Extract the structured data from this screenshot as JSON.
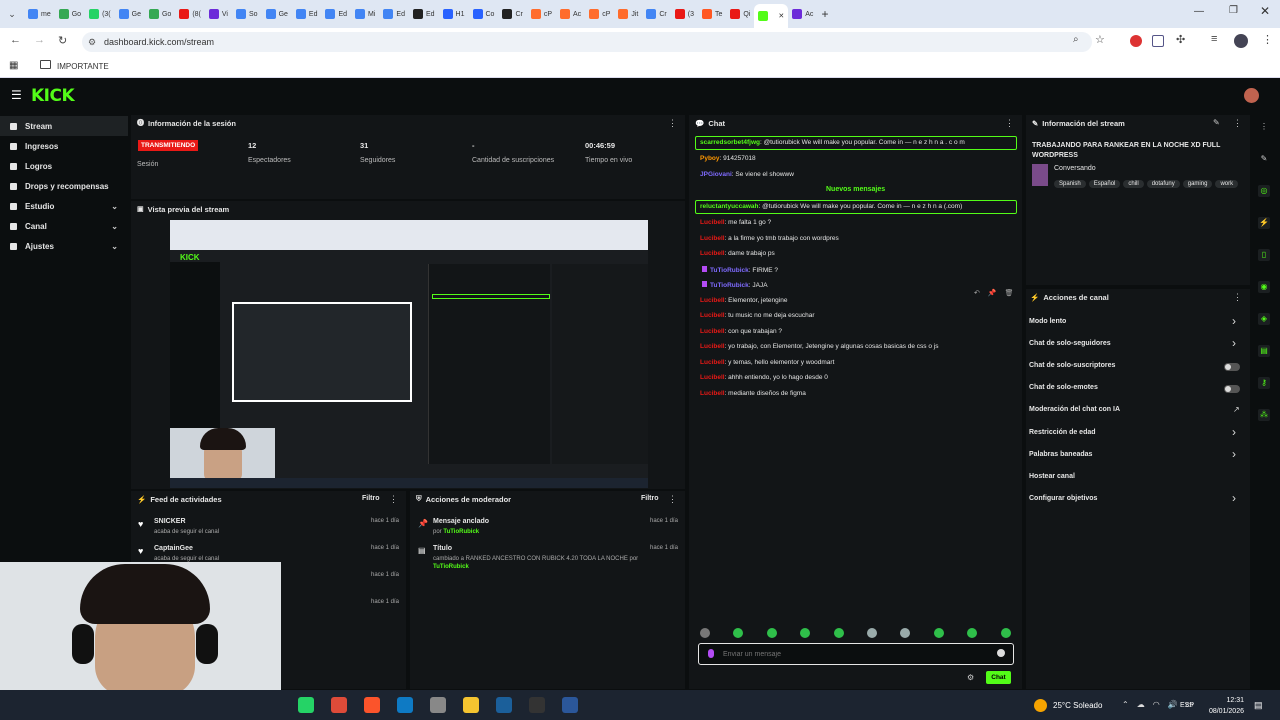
{
  "browser": {
    "url": "dashboard.kick.com/stream",
    "bookmark": "IMPORTANTE",
    "tabs": [
      {
        "label": "me",
        "color": "#4285f4"
      },
      {
        "label": "Go",
        "color": "#34a853"
      },
      {
        "label": "(3(",
        "color": "#25d366"
      },
      {
        "label": "Ge",
        "color": "#4285f4"
      },
      {
        "label": "Go",
        "color": "#34a853"
      },
      {
        "label": "(8(",
        "color": "#e91916"
      },
      {
        "label": "Vi",
        "color": "#6c2bd9"
      },
      {
        "label": "So",
        "color": "#4285f4"
      },
      {
        "label": "Ge",
        "color": "#4285f4"
      },
      {
        "label": "Ed",
        "color": "#4285f4"
      },
      {
        "label": "Ed",
        "color": "#4285f4"
      },
      {
        "label": "Mi",
        "color": "#4285f4"
      },
      {
        "label": "Ed",
        "color": "#4285f4"
      },
      {
        "label": "Ed",
        "color": "#222"
      },
      {
        "label": "H1",
        "color": "#2962ff"
      },
      {
        "label": "Co",
        "color": "#2962ff"
      },
      {
        "label": "Cr",
        "color": "#222"
      },
      {
        "label": "cP",
        "color": "#ff6c2c"
      },
      {
        "label": "Ac",
        "color": "#ff6c2c"
      },
      {
        "label": "cP",
        "color": "#ff6c2c"
      },
      {
        "label": "Jit",
        "color": "#ff6c2c"
      },
      {
        "label": "Cr",
        "color": "#4285f4"
      },
      {
        "label": "(3",
        "color": "#e91916"
      },
      {
        "label": "Te",
        "color": "#ff5722"
      },
      {
        "label": "Qi",
        "color": "#e91916"
      },
      {
        "label": "",
        "color": "#53fc18"
      },
      {
        "label": "Ac",
        "color": "#6c2bd9"
      }
    ]
  },
  "brand": {
    "logo": "KICK"
  },
  "sidebar": {
    "items": [
      {
        "label": "Stream",
        "active": true
      },
      {
        "label": "Ingresos"
      },
      {
        "label": "Logros"
      },
      {
        "label": "Drops y recompensas"
      },
      {
        "label": "Estudio",
        "chevron": true
      },
      {
        "label": "Canal",
        "chevron": true
      },
      {
        "label": "Ajustes",
        "chevron": true
      }
    ]
  },
  "session": {
    "title": "Información de la sesión",
    "badge": "TRANSMITIENDO",
    "badge_label": "Sesión",
    "stats": [
      {
        "value": "12",
        "label": "Espectadores"
      },
      {
        "value": "31",
        "label": "Seguidores"
      },
      {
        "value": "-",
        "label": "Cantidad de suscripciones"
      },
      {
        "value": "00:46:59",
        "label": "Tiempo en vivo"
      }
    ]
  },
  "preview": {
    "title": "Vista previa del stream"
  },
  "activity": {
    "title": "Feed de actividades",
    "filter": "Filtro",
    "items": [
      {
        "name": "SNICKER",
        "sub": "acaba de seguir el canal",
        "time": "hace 1 día"
      },
      {
        "name": "CaptainGee",
        "sub": "acaba de seguir el canal",
        "time": "hace 1 día"
      },
      {
        "name": "",
        "sub": "",
        "time": "hace 1 día"
      },
      {
        "name": "",
        "sub": "",
        "time": "hace 1 día"
      }
    ]
  },
  "mod": {
    "title": "Acciones de moderador",
    "filter": "Filtro",
    "items": [
      {
        "title": "Mensaje anclado",
        "by": "por",
        "user": "TuTioRubick",
        "time": "hace 1 día"
      },
      {
        "title": "Título",
        "by": "cambiado a RANKED ANCESTRO CON RUBICK 4.20 TODA LA NOCHE por",
        "user": "TuTioRubick",
        "time": "hace 1 día"
      }
    ]
  },
  "chat": {
    "title": "Chat",
    "separator": "Nuevos mensajes",
    "spam1_user": "scarredsorbet4fjwg",
    "spam1_text": ": @tutiorubick We will make you popular. Come in — n e z h n a . c o m",
    "pre": [
      {
        "user": "Pyboy",
        "text": ": 914257018",
        "color": "#ff9800"
      },
      {
        "user": "JPGiovani",
        "text": ": Se viene el showww",
        "color": "#7f6bff"
      }
    ],
    "spam2_user": "reluctantyuccawah",
    "spam2_text": ": @tutiorubick We will make you popular. Come in — n e z h n a (.com)",
    "messages": [
      {
        "user": "Lucibell",
        "text": ": me falta 1 go ?",
        "color": "#e91916"
      },
      {
        "user": "Lucibell",
        "text": ": a la firme yo tmb trabajo con wordpres",
        "color": "#e91916"
      },
      {
        "user": "Lucibell",
        "text": ": dame trabajo ps",
        "color": "#e91916"
      },
      {
        "user": "TuTioRubick",
        "text": ": FIRME ?",
        "color": "#7f6bff"
      },
      {
        "user": "TuTioRubick",
        "text": ": JAJA",
        "color": "#7f6bff"
      },
      {
        "user": "Lucibell",
        "text": ": Elementor, jetengine",
        "color": "#e91916"
      },
      {
        "user": "Lucibell",
        "text": ": tu music no me deja escuchar",
        "color": "#e91916"
      },
      {
        "user": "Lucibell",
        "text": ": con que trabajan ?",
        "color": "#e91916"
      },
      {
        "user": "Lucibell",
        "text": ": yo trabajo, con Elementor, Jetengine y algunas cosas basicas de css o js",
        "color": "#e91916"
      },
      {
        "user": "Lucibell",
        "text": ": y temas, hello elementor y woodmart",
        "color": "#e91916"
      },
      {
        "user": "Lucibell",
        "text": ": ahhh entiendo, yo lo hago desde 0",
        "color": "#e91916"
      },
      {
        "user": "Lucibell",
        "text": ": mediante diseños de figma",
        "color": "#e91916"
      }
    ],
    "placeholder": "Enviar un mensaje",
    "send": "Chat"
  },
  "streaminfo": {
    "title": "Información del stream",
    "stream_title": "TRABAJANDO PARA RANKEAR EN LA NOCHE XD FULL WORDPRESS",
    "category": "Conversando",
    "tags": [
      "Spanish",
      "Español",
      "chill",
      "dotafuny",
      "gaming",
      "work"
    ]
  },
  "actions": {
    "title": "Acciones de canal",
    "items": [
      {
        "label": "Modo lento",
        "kind": "chevron"
      },
      {
        "label": "Chat de solo-seguidores",
        "kind": "chevron"
      },
      {
        "label": "Chat de solo-suscriptores",
        "kind": "toggle"
      },
      {
        "label": "Chat de solo-emotes",
        "kind": "toggle"
      },
      {
        "label": "Moderación del chat con IA",
        "kind": "link"
      },
      {
        "label": "Restricción de edad",
        "kind": "chevron"
      },
      {
        "label": "Palabras baneadas",
        "kind": "chevron"
      },
      {
        "label": "Hostear canal",
        "kind": "none"
      },
      {
        "label": "Configurar objetivos",
        "kind": "chevron"
      }
    ]
  },
  "taskbar": {
    "weather": "25°C Soleado",
    "lang": "ESP",
    "time": "12:31",
    "date": "08/01/2026"
  }
}
